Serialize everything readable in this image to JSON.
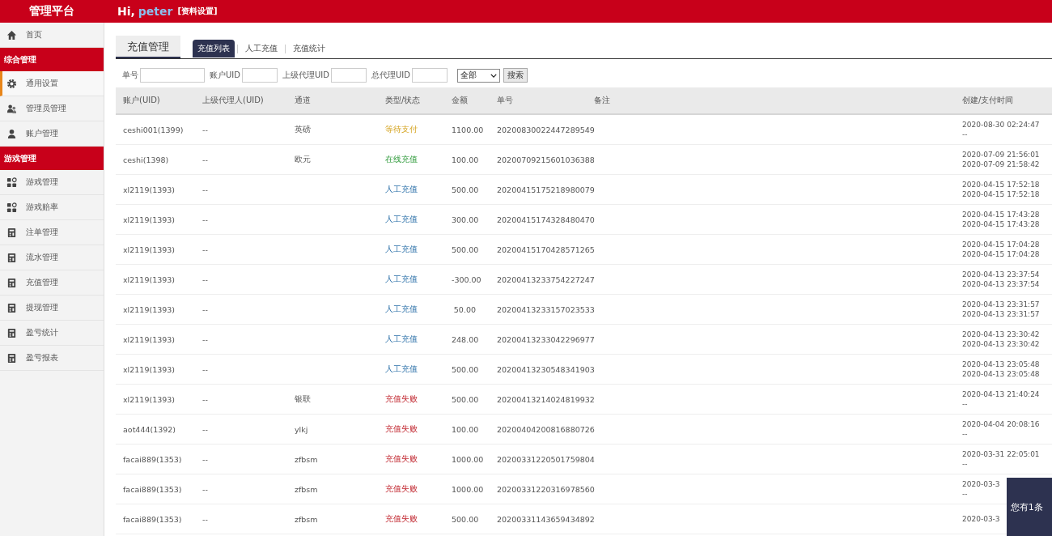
{
  "header": {
    "brand": "管理平台",
    "greeting": "Hi,",
    "username": "peter",
    "profile_link": "[资料设置]"
  },
  "sidebar": {
    "items": [
      {
        "kind": "item",
        "label": "首页",
        "selected": false
      },
      {
        "kind": "section",
        "label": "综合管理"
      },
      {
        "kind": "item",
        "label": "通用设置",
        "selected": true
      },
      {
        "kind": "item",
        "label": "管理员管理",
        "selected": false
      },
      {
        "kind": "item",
        "label": "账户管理",
        "selected": false
      },
      {
        "kind": "section",
        "label": "游戏管理"
      },
      {
        "kind": "item",
        "label": "游戏管理",
        "selected": false
      },
      {
        "kind": "item",
        "label": "游戏赔率",
        "selected": false
      },
      {
        "kind": "item",
        "label": "注单管理",
        "selected": false
      },
      {
        "kind": "item",
        "label": "流水管理",
        "selected": false
      },
      {
        "kind": "item",
        "label": "充值管理",
        "selected": false
      },
      {
        "kind": "item",
        "label": "提现管理",
        "selected": false
      },
      {
        "kind": "item",
        "label": "盈亏统计",
        "selected": false
      },
      {
        "kind": "item",
        "label": "盈亏报表",
        "selected": false
      }
    ]
  },
  "page_tab": {
    "label": "充值管理",
    "selected": true
  },
  "tabs": [
    {
      "label": "充值列表",
      "selected": true
    },
    {
      "label": "人工充值",
      "selected": false
    },
    {
      "label": "充值统计",
      "selected": false
    }
  ],
  "filters": {
    "fields": [
      {
        "label": "单号"
      },
      {
        "label": "账户UID"
      },
      {
        "label": "上级代理UID"
      },
      {
        "label": "总代理UID"
      }
    ],
    "select": {
      "value": "全部"
    },
    "button": "搜索"
  },
  "table": {
    "columns": [
      "账户(UID)",
      "上级代理人(UID)",
      "通道",
      "类型/状态",
      "金额",
      "单号",
      "备注",
      "创建/支付时间"
    ],
    "rows": [
      {
        "account": "ceshi001(1399)",
        "agent": "--",
        "channel": "英磅",
        "status": "等待支付",
        "kind": "pending",
        "amount": "1100.00",
        "order": "20200830022447289549",
        "times": [
          "2020-08-30 02:24:47",
          "--"
        ]
      },
      {
        "account": "ceshi(1398)",
        "agent": "--",
        "channel": "欧元",
        "status": "在线充值",
        "kind": "online",
        "amount": "100.00",
        "order": "20200709215601036388",
        "times": [
          "2020-07-09 21:56:01",
          "2020-07-09 21:58:42"
        ]
      },
      {
        "account": "xl2119(1393)",
        "agent": "--",
        "status": "人工充值",
        "kind": "manual",
        "amount": "500.00",
        "order": "20200415175218980079",
        "times": [
          "2020-04-15 17:52:18",
          "2020-04-15 17:52:18"
        ]
      },
      {
        "account": "xl2119(1393)",
        "agent": "--",
        "status": "人工充值",
        "kind": "manual",
        "amount": "300.00",
        "order": "20200415174328480470",
        "times": [
          "2020-04-15 17:43:28",
          "2020-04-15 17:43:28"
        ]
      },
      {
        "account": "xl2119(1393)",
        "agent": "--",
        "status": "人工充值",
        "kind": "manual",
        "amount": "500.00",
        "order": "20200415170428571265",
        "times": [
          "2020-04-15 17:04:28",
          "2020-04-15 17:04:28"
        ]
      },
      {
        "account": "xl2119(1393)",
        "agent": "--",
        "status": "人工充值",
        "kind": "manual",
        "amount": "-300.00",
        "order": "20200413233754227247",
        "times": [
          "2020-04-13 23:37:54",
          "2020-04-13 23:37:54"
        ]
      },
      {
        "account": "xl2119(1393)",
        "agent": "--",
        "status": "人工充值",
        "kind": "manual",
        "amount": "50.00",
        "order": "20200413233157023533",
        "times": [
          "2020-04-13 23:31:57",
          "2020-04-13 23:31:57"
        ]
      },
      {
        "account": "xl2119(1393)",
        "agent": "--",
        "status": "人工充值",
        "kind": "manual",
        "amount": "248.00",
        "order": "20200413233042296977",
        "times": [
          "2020-04-13 23:30:42",
          "2020-04-13 23:30:42"
        ]
      },
      {
        "account": "xl2119(1393)",
        "agent": "--",
        "status": "人工充值",
        "kind": "manual",
        "amount": "500.00",
        "order": "20200413230548341903",
        "times": [
          "2020-04-13 23:05:48",
          "2020-04-13 23:05:48"
        ]
      },
      {
        "account": "xl2119(1393)",
        "agent": "--",
        "channel": "银联",
        "status": "充值失败",
        "kind": "failed",
        "amount": "500.00",
        "order": "20200413214024819932",
        "times": [
          "2020-04-13 21:40:24",
          "--"
        ]
      },
      {
        "account": "aot444(1392)",
        "agent": "--",
        "channel": "ylkj",
        "status": "充值失败",
        "kind": "failed",
        "amount": "100.00",
        "order": "20200404200816880726",
        "times": [
          "2020-04-04 20:08:16",
          "--"
        ]
      },
      {
        "account": "facai889(1353)",
        "agent": "--",
        "channel": "zfbsm",
        "status": "充值失败",
        "kind": "failed",
        "amount": "1000.00",
        "order": "20200331220501759804",
        "times": [
          "2020-03-31 22:05:01",
          "--"
        ]
      },
      {
        "account": "facai889(1353)",
        "agent": "--",
        "channel": "zfbsm",
        "status": "充值失败",
        "kind": "failed",
        "amount": "1000.00",
        "order": "20200331220316978560",
        "times": [
          "2020-03-3",
          "--"
        ]
      },
      {
        "account": "facai889(1353)",
        "agent": "--",
        "channel": "zfbsm",
        "status": "充值失败",
        "kind": "failed",
        "amount": "500.00",
        "order": "20200331143659434892",
        "times": [
          "2020-03-3"
        ]
      }
    ]
  },
  "toast": {
    "text": "您有1条"
  }
}
